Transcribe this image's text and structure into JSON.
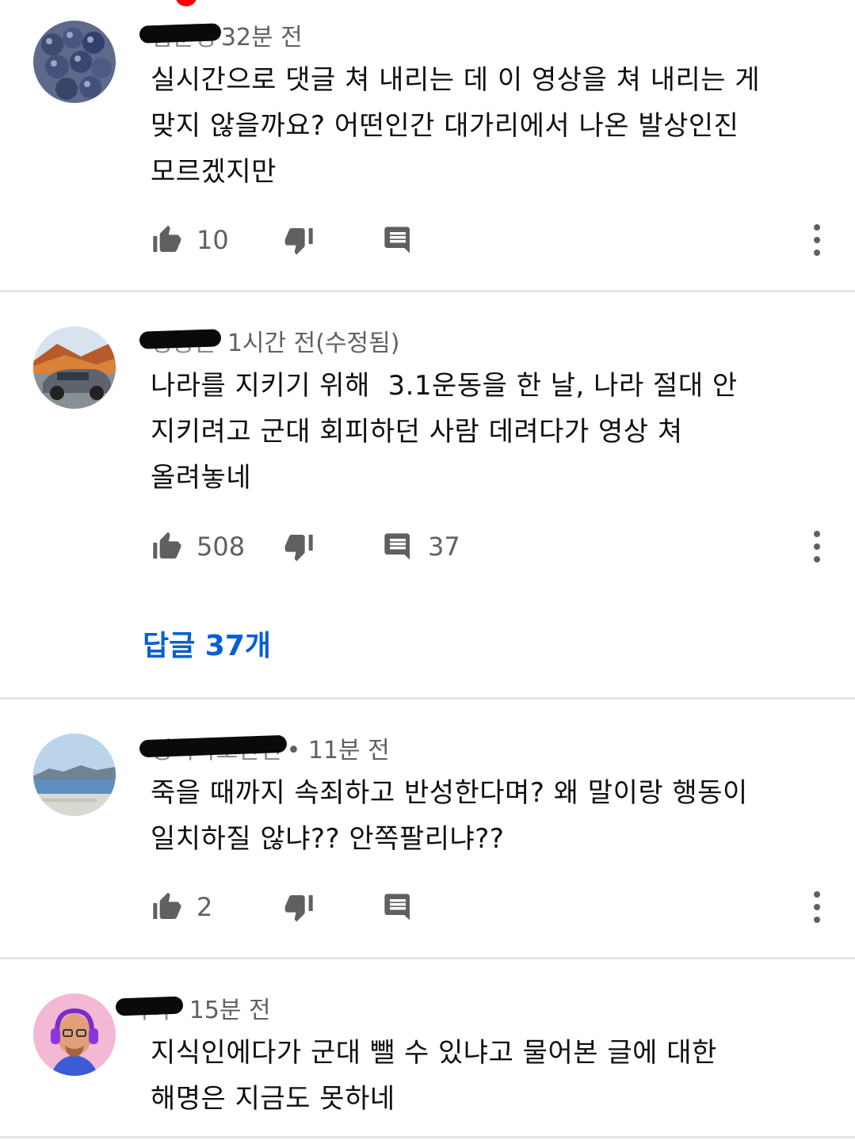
{
  "comments": [
    {
      "time": "32분 전",
      "text_lines": [
        "실시간으로 댓글 쳐 내리는 데 이 영상을 쳐 내리는 게",
        "맞지 않을까요? 어떤인간 대가리에서 나온 발상인진",
        "모르겠지만"
      ],
      "likes": "10",
      "replies": ""
    },
    {
      "time": "1시간 전(수정됨)",
      "text_lines": [
        "나라를 지키기 위해  3.1운동을 한 날, 나라 절대 안",
        "지키려고 군대 회피하던 사람 데려다가 영상 쳐",
        "올려놓네"
      ],
      "likes": "508",
      "replies": "37",
      "replies_link": "답글 37개"
    },
    {
      "time": "• 11분 전",
      "text_lines": [
        "죽을 때까지 속죄하고 반성한다며? 왜 말이랑 행동이",
        "일치하질 않냐?? 안쪽팔리냐??"
      ],
      "likes": "2",
      "replies": ""
    },
    {
      "time": "15분 전",
      "text_lines": [
        "지식인에다가 군대 뺄 수 있냐고 물어본 글에 대한",
        "해명은 지금도 못하네"
      ]
    }
  ],
  "icons": {
    "like": "thumb-up-icon",
    "dislike": "thumb-down-icon",
    "reply": "comment-icon",
    "more": "more-vert-icon"
  },
  "colors": {
    "link": "#065fd4",
    "icon": "#606060",
    "divider": "#e6e6e6"
  }
}
